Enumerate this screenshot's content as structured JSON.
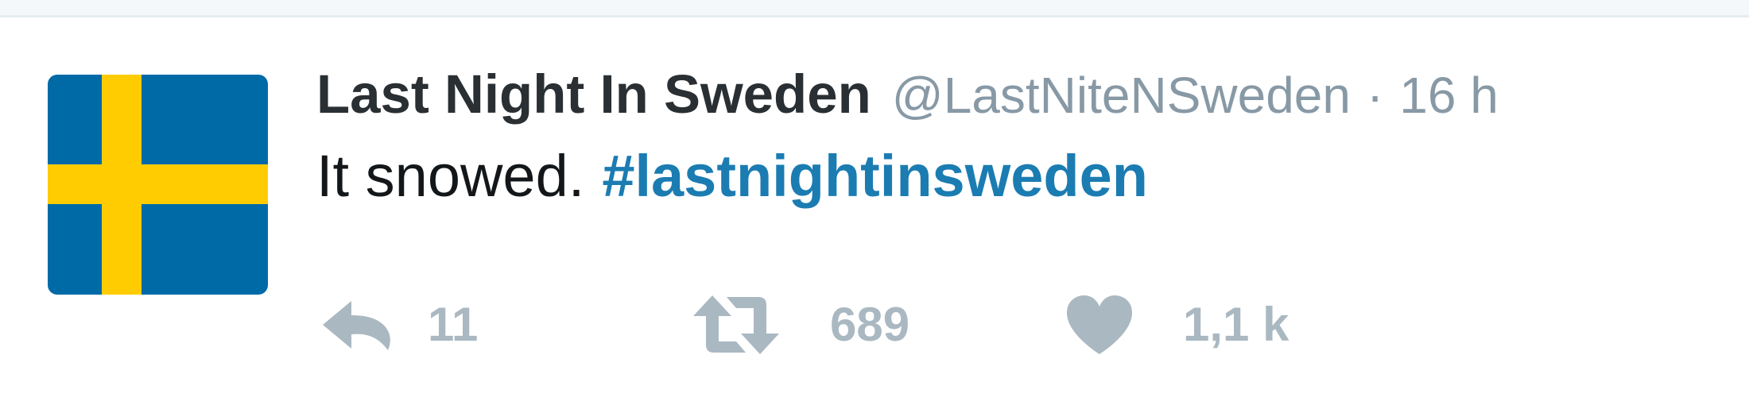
{
  "tweet": {
    "full_name": "Last Night In Sweden",
    "username": "@LastNiteNSweden",
    "separator": "·",
    "timestamp": "16 h",
    "text": "It snowed.",
    "hashtag": "#lastnightinsweden",
    "avatar": {
      "description_icon": "sweden-flag-icon",
      "colors": {
        "blue": "#006aa7",
        "yellow": "#fecc00"
      }
    },
    "actions": {
      "reply": {
        "icon": "reply-icon",
        "count": "11"
      },
      "retweet": {
        "icon": "retweet-icon",
        "count": "689"
      },
      "like": {
        "icon": "heart-icon",
        "count": "1,1 k"
      }
    }
  },
  "colors": {
    "name": "#292f33",
    "meta": "#8899a6",
    "hashtag": "#1b7cb2",
    "action": "#aab8c2"
  }
}
